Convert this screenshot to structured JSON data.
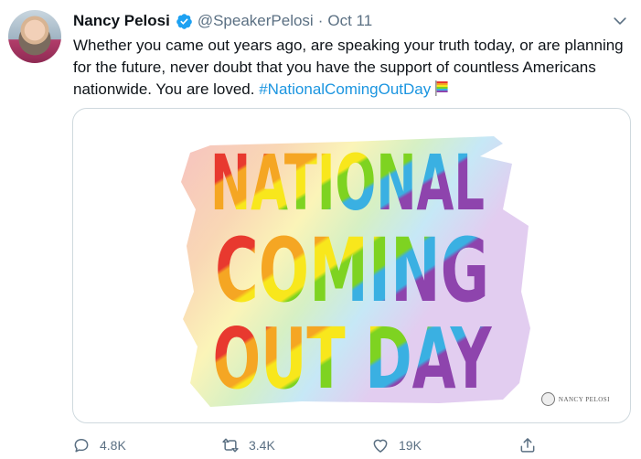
{
  "author": {
    "name": "Nancy Pelosi",
    "handle": "@SpeakerPelosi",
    "separator": "·",
    "date": "Oct 11",
    "verified": true
  },
  "tweet": {
    "text": "Whether you came out years ago, are speaking your truth today, or are planning for the future, never doubt that you have the support of countless Americans nationwide. You are loved. ",
    "hashtag": "#NationalComingOutDay",
    "emoji": "rainbow-flag-icon"
  },
  "media": {
    "lines": [
      "NATIONAL",
      "COMING",
      "OUT DAY"
    ],
    "watermark": "NANCY PELOSI",
    "colors": [
      "#e8392f",
      "#f5a623",
      "#f8e71c",
      "#7ed321",
      "#3ab0e2",
      "#8e44ad"
    ]
  },
  "actions": {
    "reply_count": "4.8K",
    "retweet_count": "3.4K",
    "like_count": "19K"
  },
  "colors": {
    "link": "#1b95e0",
    "secondary_text": "#5b7083",
    "verified": "#1da1f2"
  }
}
